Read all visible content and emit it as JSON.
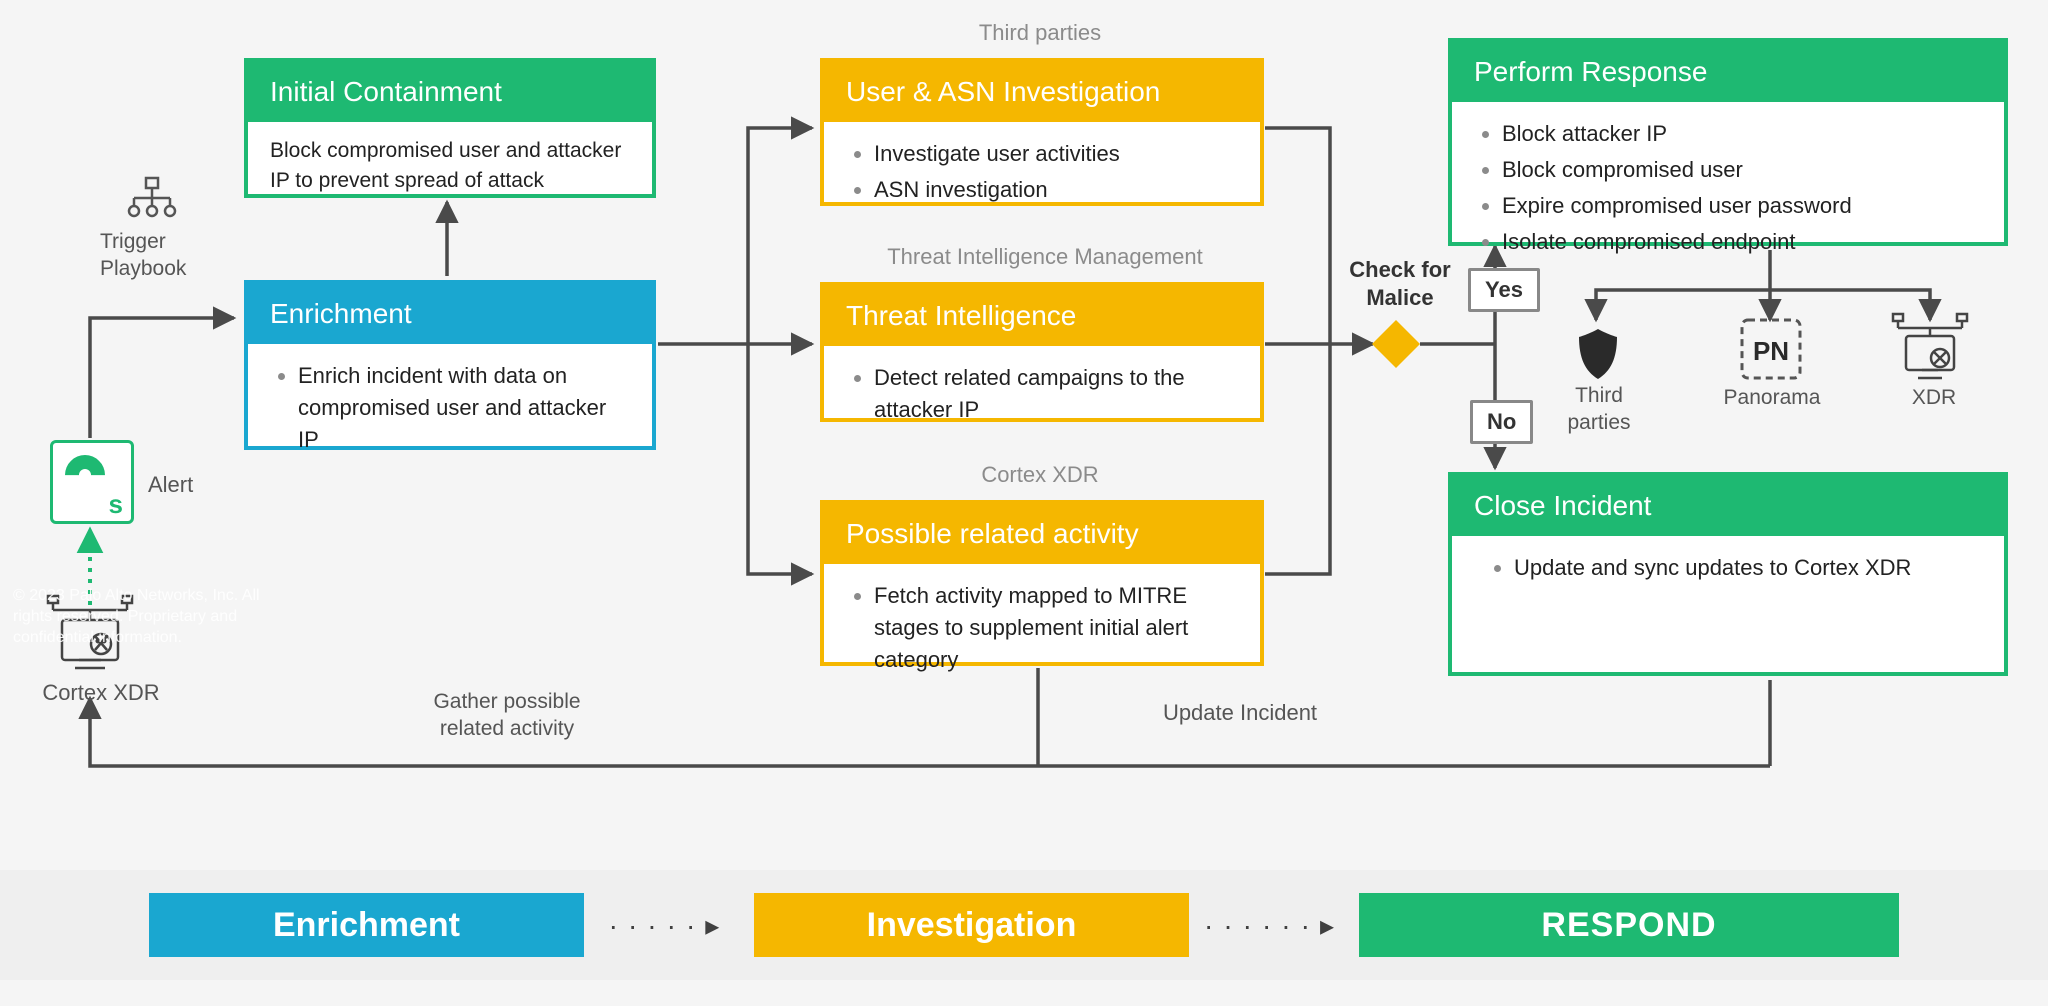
{
  "labels": {
    "third_parties": "Third parties",
    "tim": "Threat Intelligence Management",
    "cortex_xdr": "Cortex XDR",
    "trigger1": "Trigger",
    "trigger2": "Playbook",
    "alert": "Alert",
    "cortex_src": "Cortex XDR",
    "gather1": "Gather possible",
    "gather2": "related activity",
    "update": "Update Incident",
    "check1": "Check for",
    "check2": "Malice",
    "yes": "Yes",
    "no": "No",
    "resp_third": "Third parties",
    "resp_panorama": "Panorama",
    "resp_xdr": "XDR"
  },
  "boxes": {
    "containment": {
      "title": "Initial Containment",
      "body_text": "Block compromised user and attacker IP to prevent spread of attack"
    },
    "enrichment": {
      "title": "Enrichment",
      "items": [
        "Enrich incident with data on compromised user and attacker IP"
      ]
    },
    "user_asn": {
      "title": "User & ASN Investigation",
      "items": [
        "Investigate user activities",
        "ASN investigation"
      ]
    },
    "ti": {
      "title": "Threat Intelligence",
      "items": [
        "Detect related campaigns to the attacker IP"
      ]
    },
    "related": {
      "title": "Possible related activity",
      "items": [
        "Fetch activity mapped to MITRE stages to supplement initial alert category"
      ]
    },
    "response": {
      "title": "Perform Response",
      "items": [
        "Block attacker IP",
        "Block compromised user",
        "Expire compromised user password",
        "Isolate compromised endpoint"
      ]
    },
    "close": {
      "title": "Close Incident",
      "items": [
        "Update and sync updates to Cortex XDR"
      ]
    }
  },
  "phases": {
    "p1": "Enrichment",
    "p2": "Investigation",
    "p3": "RESPOND"
  },
  "watermark": "© 2023 Palo Alto Networks, Inc. All rights reserved. Proprietary and confidential information."
}
